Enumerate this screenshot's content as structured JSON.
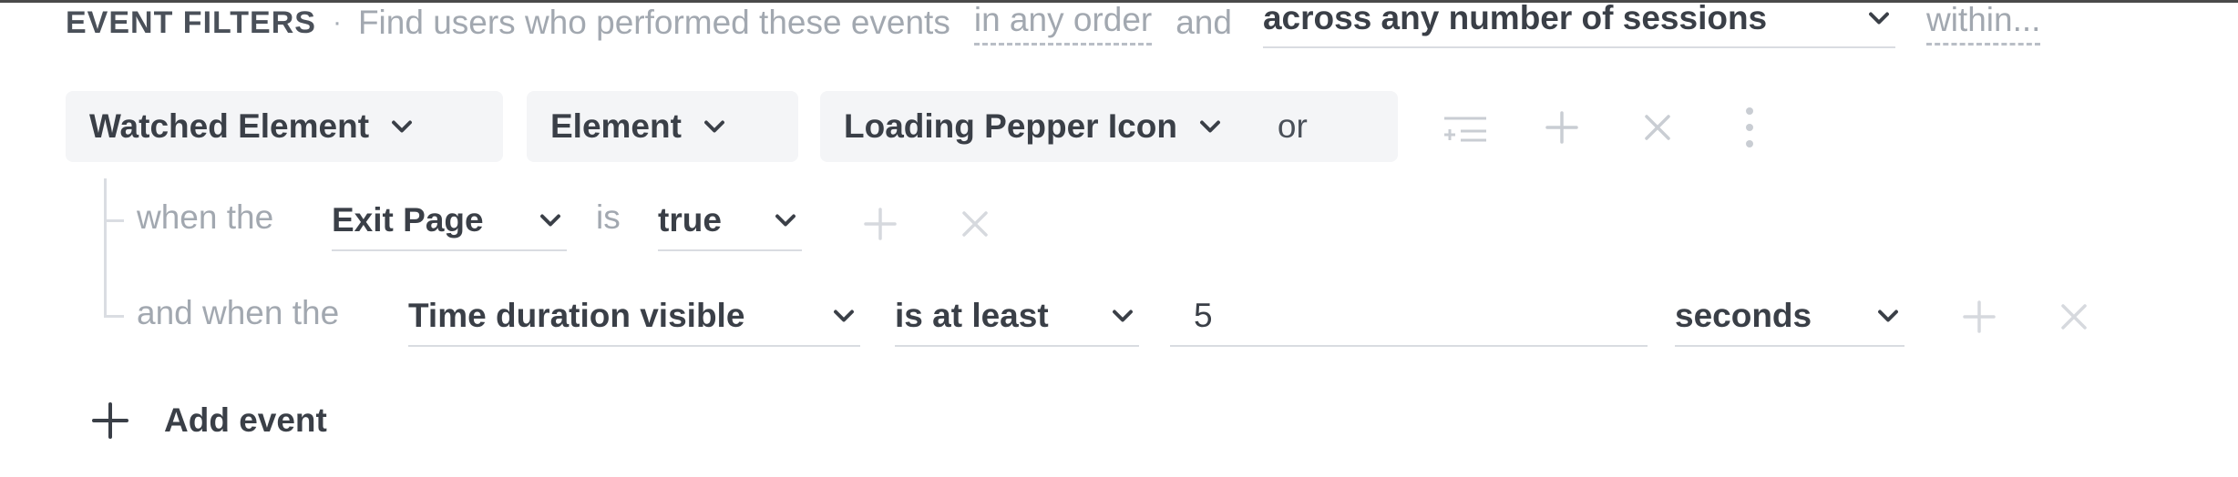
{
  "header": {
    "title": "EVENT FILTERS",
    "separator": "·",
    "description": "Find users who performed these events",
    "order_link": "in any order",
    "and_text": "and",
    "sessions_select": "across any number of sessions",
    "within_link": "within..."
  },
  "event": {
    "event_name": "Watched Element",
    "property": "Element",
    "value": "Loading Pepper Icon",
    "or_text": "or"
  },
  "conditions": [
    {
      "prefix": "when the",
      "property": "Exit Page",
      "operator": "is",
      "value": "true"
    },
    {
      "prefix": "and when the",
      "property": "Time duration visible",
      "operator": "is at least",
      "value": "5",
      "unit": "seconds"
    }
  ],
  "add_event_label": "Add event",
  "icons": {
    "chevron": "chevron-down-icon",
    "filter": "filter-lines-icon",
    "plus": "plus-icon",
    "close": "close-icon",
    "more": "more-vertical-icon"
  },
  "colors": {
    "text_dark": "#3a3f47",
    "text_muted": "#a2a8b0",
    "pill_bg": "#f4f5f7",
    "icon_muted": "#c9cdd3"
  }
}
